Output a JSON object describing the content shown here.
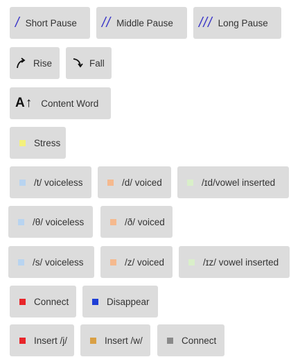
{
  "pauses": [
    {
      "symbol": "/",
      "label": "Short Pause"
    },
    {
      "symbol": "//",
      "label": "Middle Pause"
    },
    {
      "symbol": "///",
      "label": "Long Pause"
    }
  ],
  "intonation": [
    {
      "icon": "rise-arrow-icon",
      "label": "Rise"
    },
    {
      "icon": "fall-arrow-icon",
      "label": "Fall"
    }
  ],
  "content_word": {
    "symbol": "A↑",
    "label": "Content Word"
  },
  "stress": {
    "label": "Stress",
    "color": "#f3f07c"
  },
  "ed_row1": [
    {
      "label": "/t/ voiceless",
      "color": "#b8d4f0"
    },
    {
      "label": "/d/ voiced",
      "color": "#f5b98e"
    },
    {
      "label": "/ɪd/vowel inserted",
      "color": "#d9efc9"
    }
  ],
  "th_row": [
    {
      "label": "/θ/ voiceless",
      "color": "#b8d4f0"
    },
    {
      "label": "/ð/ voiced",
      "color": "#f5b98e"
    }
  ],
  "s_row": [
    {
      "label": "/s/ voiceless",
      "color": "#b8d4f0"
    },
    {
      "label": "/z/ voiced",
      "color": "#f5b98e"
    },
    {
      "label": "/ɪz/ vowel inserted",
      "color": "#d9efc9"
    }
  ],
  "linking": [
    {
      "label": "Connect",
      "color": "#e8262a"
    },
    {
      "label": "Disappear",
      "color": "#1f3fd6"
    }
  ],
  "insert_row": [
    {
      "label": "Insert /j/",
      "color": "#e8262a"
    },
    {
      "label": "Insert /w/",
      "color": "#d9a045"
    },
    {
      "label": "Connect",
      "color": "#8a8a8a"
    }
  ]
}
